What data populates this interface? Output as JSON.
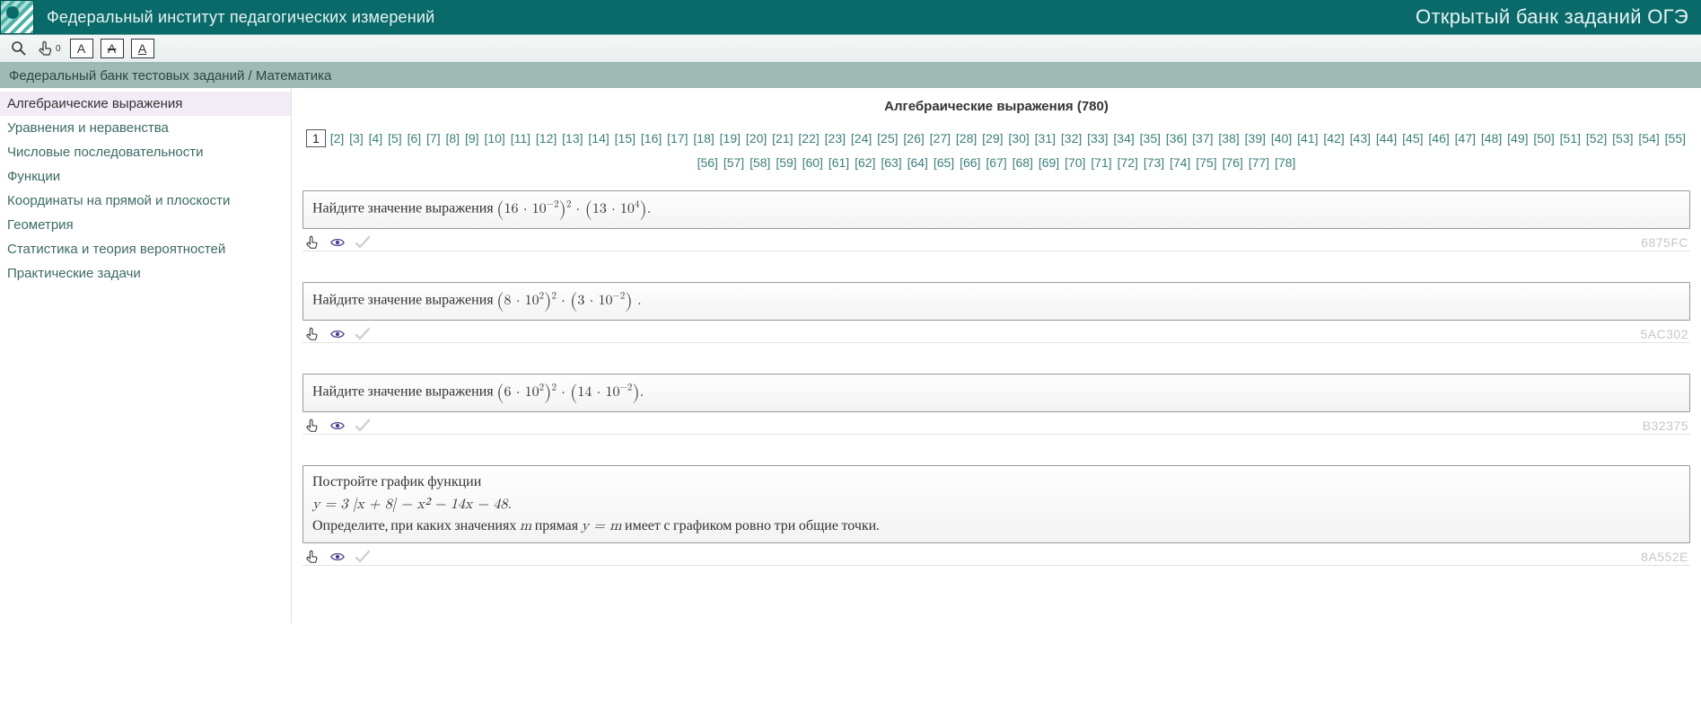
{
  "header": {
    "title_left": "Федеральный институт педагогических измерений",
    "title_right": "Открытый банк заданий ОГЭ"
  },
  "toolbar": {
    "search_icon": "search",
    "select_icon": "hand-pointer",
    "select_badge": "0",
    "font_normal": "A",
    "font_strike": "A",
    "font_under": "A"
  },
  "breadcrumb": {
    "text": "Федеральный банк тестовых заданий / Математика"
  },
  "sidebar": {
    "items": [
      {
        "label": "Алгебраические выражения",
        "active": true
      },
      {
        "label": "Уравнения и неравенства",
        "active": false
      },
      {
        "label": "Числовые последовательности",
        "active": false
      },
      {
        "label": "Функции",
        "active": false
      },
      {
        "label": "Координаты на прямой и плоскости",
        "active": false
      },
      {
        "label": "Геометрия",
        "active": false
      },
      {
        "label": "Статистика и теория вероятностей",
        "active": false
      },
      {
        "label": "Практические задачи",
        "active": false
      }
    ]
  },
  "page_title": "Алгебраические выражения (780)",
  "pager": {
    "current": 1,
    "total": 78
  },
  "tasks": [
    {
      "prefix": "Найдите значение выражения ",
      "expr_html": "<span class='paren'>(</span>16 · 10<sup>−2</sup><span class='paren'>)</span><sup>2</sup> · <span class='paren'>(</span>13 · 10<sup>4</sup><span class='paren'>)</span>.",
      "code": "6875FC"
    },
    {
      "prefix": "Найдите значение выражения ",
      "expr_html": "<span class='paren'>(</span>8 · 10<sup>2</sup><span class='paren'>)</span><sup>2</sup> · <span class='paren'>(</span>3 · 10<sup>−2</sup><span class='paren'>)</span> .",
      "code": "5AC302"
    },
    {
      "prefix": "Найдите значение выражения ",
      "expr_html": "<span class='paren'>(</span>6 · 10<sup>2</sup><span class='paren'>)</span><sup>2</sup> · <span class='paren'>(</span>14 · 10<sup>−2</sup><span class='paren'>)</span>.",
      "code": "B32375"
    },
    {
      "prefix": "Постройте график функции",
      "equation": "y = 3 |x + 8| − x² − 14x − 48.",
      "suffix_before_m": "Определите, при каких значениях ",
      "m_var": "m",
      "suffix_mid": " прямая ",
      "y_eq_m": "y = m",
      "suffix_after": " имеет с графиком ровно три общие точки.",
      "code": "8A552E"
    }
  ]
}
